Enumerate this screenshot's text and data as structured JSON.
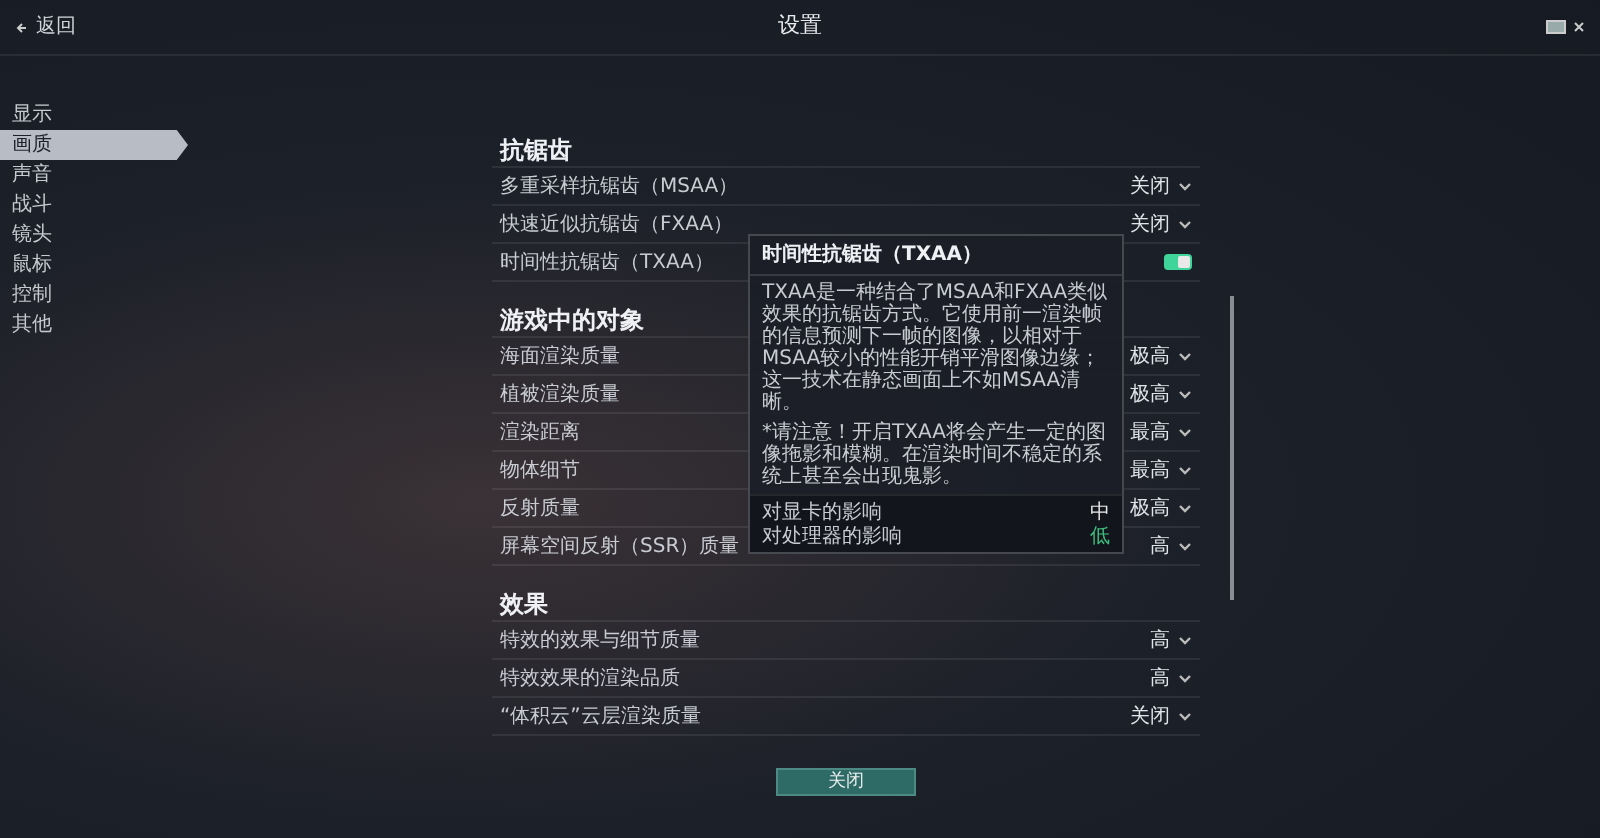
{
  "header": {
    "back": "返回",
    "title": "设置"
  },
  "sidebar": {
    "items": [
      {
        "label": "显示",
        "selected": false
      },
      {
        "label": "画质",
        "selected": true
      },
      {
        "label": "声音",
        "selected": false
      },
      {
        "label": "战斗",
        "selected": false
      },
      {
        "label": "镜头",
        "selected": false
      },
      {
        "label": "鼠标",
        "selected": false
      },
      {
        "label": "控制",
        "selected": false
      },
      {
        "label": "其他",
        "selected": false
      }
    ]
  },
  "sections": [
    {
      "title": "抗锯齿",
      "rows": [
        {
          "kind": "dropdown",
          "label": "多重采样抗锯齿（MSAA）",
          "value": "关闭"
        },
        {
          "kind": "dropdown",
          "label": "快速近似抗锯齿（FXAA）",
          "value": "关闭"
        },
        {
          "kind": "toggle",
          "label": "时间性抗锯齿（TXAA）",
          "on": true
        }
      ]
    },
    {
      "title": "游戏中的对象",
      "rows": [
        {
          "kind": "dropdown",
          "label": "海面渲染质量",
          "value": "极高"
        },
        {
          "kind": "dropdown",
          "label": "植被渲染质量",
          "value": "极高"
        },
        {
          "kind": "dropdown",
          "label": "渲染距离",
          "value": "最高"
        },
        {
          "kind": "dropdown",
          "label": "物体细节",
          "value": "最高"
        },
        {
          "kind": "dropdown",
          "label": "反射质量",
          "value": "极高"
        },
        {
          "kind": "dropdown",
          "label": "屏幕空间反射（SSR）质量",
          "value": "高"
        }
      ]
    },
    {
      "title": "效果",
      "rows": [
        {
          "kind": "dropdown",
          "label": "特效的效果与细节质量",
          "value": "高"
        },
        {
          "kind": "dropdown",
          "label": "特效效果的渲染品质",
          "value": "高"
        },
        {
          "kind": "dropdown",
          "label": "“体积云”云层渲染质量",
          "value": "关闭"
        }
      ]
    }
  ],
  "tooltip": {
    "title": "时间性抗锯齿（TXAA）",
    "paragraphs": [
      "TXAA是一种结合了MSAA和FXAA类似效果的抗锯齿方式。它使用前一渲染帧的信息预测下一帧的图像，以相对于MSAA较小的性能开销平滑图像边缘；这一技术在静态画面上不如MSAA清晰。",
      "*请注意！开启TXAA将会产生一定的图像拖影和模糊。在渲染时间不稳定的系统上甚至会出现鬼影。"
    ],
    "impacts": [
      {
        "label": "对显卡的影响",
        "value": "中",
        "color": "#e6e6e6"
      },
      {
        "label": "对处理器的影响",
        "value": "低",
        "color": "#3fbf7f"
      }
    ]
  },
  "close_button": "关闭"
}
